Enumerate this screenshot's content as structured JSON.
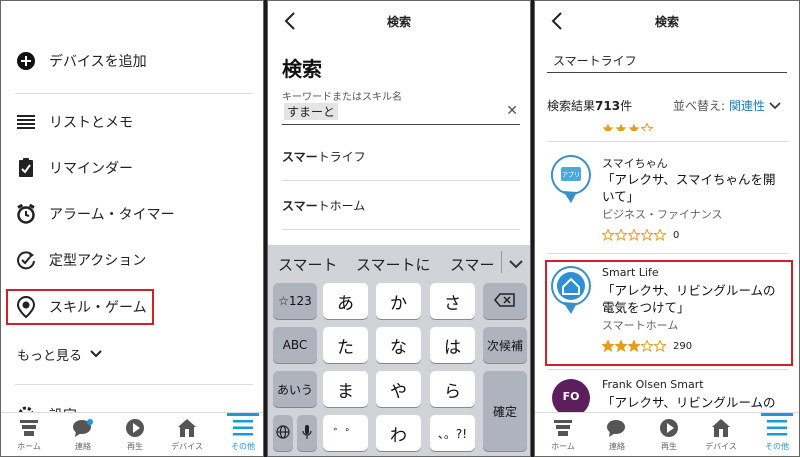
{
  "panel1": {
    "menu": [
      {
        "label": "デバイスを追加",
        "icon": "plus-circle-icon"
      },
      {
        "label": "リストとメモ",
        "icon": "list-icon"
      },
      {
        "label": "リマインダー",
        "icon": "clipboard-check-icon"
      },
      {
        "label": "アラーム・タイマー",
        "icon": "alarm-clock-icon"
      },
      {
        "label": "定型アクション",
        "icon": "routine-icon"
      },
      {
        "label": "スキル・ゲーム",
        "icon": "skill-pin-icon"
      }
    ],
    "more_label": "もっと見る",
    "settings_label": "設定"
  },
  "bottom_nav": [
    {
      "label": "ホーム",
      "icon": "home-icon"
    },
    {
      "label": "連絡",
      "icon": "chat-icon"
    },
    {
      "label": "再生",
      "icon": "play-icon"
    },
    {
      "label": "デバイス",
      "icon": "device-house-icon"
    },
    {
      "label": "その他",
      "icon": "menu-lines-icon",
      "active": true
    }
  ],
  "panel2": {
    "header_title": "検索",
    "big_title": "検索",
    "field_label": "キーワードまたはスキル名",
    "field_value": "すまーと",
    "suggestions": [
      {
        "bold": "スマー",
        "rest": "トライフ"
      },
      {
        "bold": "スマー",
        "rest": "トホーム"
      }
    ],
    "keyboard": {
      "candidates": [
        "スマート",
        "スマートに",
        "スマー"
      ],
      "keys": {
        "num": "☆123",
        "a": "あ",
        "ka": "か",
        "sa": "さ",
        "abc": "ABC",
        "ta": "た",
        "na": "な",
        "ha": "は",
        "next": "次候補",
        "aiu": "あいう",
        "ma": "ま",
        "ya": "や",
        "ra": "ら",
        "dakuten": "゛゜",
        "wa": "わ",
        "punct": "、。?!",
        "enter": "確定"
      }
    }
  },
  "panel3": {
    "header_title": "検索",
    "search_value": "スマートライフ",
    "results_prefix": "検索結果",
    "results_count": "713",
    "results_suffix": "件",
    "sort_label": "並べ替え:",
    "sort_value": "関連性",
    "skills": [
      {
        "name": "スマイちゃん",
        "phrase": "「アレクサ、スマイちゃんを開いて」",
        "category": "ビジネス・ファイナンス",
        "rating": 0,
        "count": "0",
        "icon_text": "アプリ"
      },
      {
        "name": "Smart Life",
        "phrase": "「アレクサ、リビングルームの電気をつけて」",
        "category": "スマートホーム",
        "rating": 3,
        "count": "290"
      },
      {
        "name": "Frank Olsen Smart",
        "phrase": "「アレクサ、リビングルームの照",
        "icon_text": "FO"
      }
    ]
  },
  "colors": {
    "accent": "#1a9bd7",
    "highlight": "#d0202a",
    "link": "#1a7fb5",
    "star": "#e89c1e"
  }
}
